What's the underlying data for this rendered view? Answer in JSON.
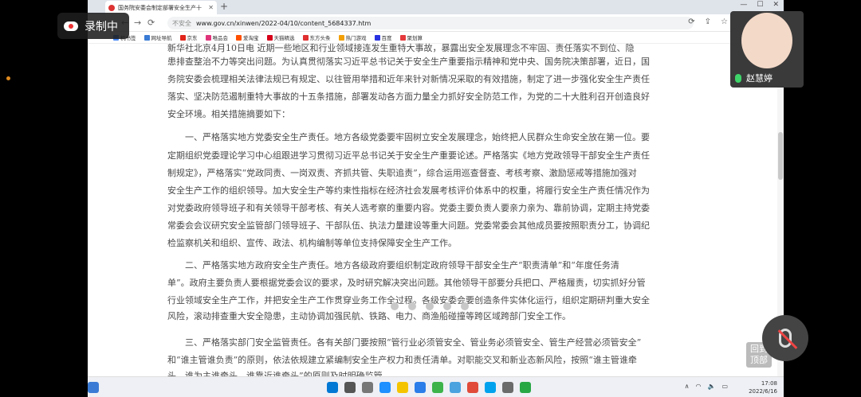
{
  "browser": {
    "tab_title": "国务院安委会制定部署安全生产十",
    "address_prefix": "不安全",
    "url": "www.gov.cn/xinwen/2022-04/10/content_5684337.htm",
    "bookmarks": [
      "机书签",
      "网址导航",
      "京东",
      "唯品会",
      "爱淘宝",
      "天猫精选",
      "东方头条",
      "热门游戏",
      "百度",
      "聚划算"
    ]
  },
  "article": {
    "lines": [
      "新华社北京4月10日电 近期一些地区和行业领域接连发生重特大事故，暴露出安全发展理念不牢固、责任落实不到位、隐",
      "患排查整治不力等突出问题。为认真贯彻落实习近平总书记关于安全生产重要指示精神和党中央、国务院决策部署，近日，国",
      "务院安委会梳理相关法律法规已有规定、以往管用举措和近年来针对新情况采取的有效措施，制定了进一步强化安全生产责任",
      "落实、坚决防范遏制重特大事故的十五条措施，部署发动各方面力量全力抓好安全防范工作，为党的二十大胜利召开创造良好",
      "安全环境。相关措施摘要如下：",
      "一、严格落实地方党委安全生产责任。地方各级党委要牢固树立安全发展理念，始终把人民群众生命安全放在第一位。要",
      "定期组织党委理论学习中心组跟进学习贯彻习近平总书记关于安全生产重要论述。严格落实《地方党政领导干部安全生产责任",
      "制规定》，严格落实“党政同责、一岗双责、齐抓共管、失职追责”，综合运用巡查督查、考核考察、激励惩戒等措施加强对",
      "安全生产工作的组织领导。加大安全生产等约束性指标在经济社会发展考核评价体系中的权重，将履行安全生产责任情况作为",
      "对党委政府领导班子和有关领导干部考核、有关人选考察的重要内容。党委主要负责人要亲力亲为、靠前协调，定期主持党委",
      "常委会会议研究安全监管部门领导班子、干部队伍、执法力量建设等重大问题。党委常委会其他成员要按照职责分工，协调纪",
      "检监察机关和组织、宣传、政法、机构编制等单位支持保障安全生产工作。",
      "二、严格落实地方政府安全生产责任。地方各级政府要组织制定政府领导干部安全生产“职责清单”和“年度任务清",
      "单”。政府主要负责人要根据党委会议的要求，及时研究解决突出问题。其他领导干部要分兵把口、严格履责，切实抓好分管",
      "行业领域安全生产工作，并把安全生产工作贯穿业务工作全过程。各级安委会要创造条件实体化运行，组织定期研判重大安全",
      "风险，滚动排查重大安全隐患，主动协调加强民航、铁路、电力、商渔船碰撞等跨区域跨部门安全工作。",
      "三、严格落实部门安全监管责任。各有关部门要按照“管行业必须管安全、管业务必须管安全、管生产经营必须管安全”",
      "和“谁主管谁负责”的原则，依法依规建立紧编制安全生产权力和责任清单。对职能交叉和新业态新风险，按照“谁主管谁牵",
      "头、谁为主谁牵头、谁靠近谁牵头”的原则及时明确监管…"
    ]
  },
  "overlay": {
    "recording_label": "录制中",
    "participant_name": "赵慧婷",
    "back_to_top": "回到\n顶部"
  },
  "taskbar": {
    "time": "17:08",
    "date": "2022/6/16"
  }
}
